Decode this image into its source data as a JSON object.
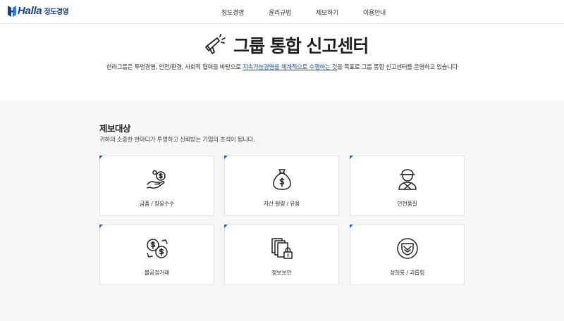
{
  "header": {
    "logo_text": "Halla",
    "logo_sub": "정도경영",
    "nav": [
      "정도경영",
      "윤리규범",
      "제보하기",
      "이용안내"
    ]
  },
  "hero": {
    "title": "그룹 통합 신고센터",
    "desc_before": "한라그룹은 투명경영, 안전/환경, 사회적 협력을 바탕으로 ",
    "desc_highlight": "지속가능경영을 체계적으로 수행하는 것",
    "desc_after": "을 목표로 그룹 통합 신고센터를 운영하고 있습니다"
  },
  "section": {
    "title": "제보대상",
    "desc": "귀하의 소중한 한마디가 투명하고 신뢰받는 기업의 초석이 됩니다."
  },
  "cards": [
    {
      "label": "금품 / 향응수수",
      "icon": "money-hand-icon"
    },
    {
      "label": "자산 횡령 / 유용",
      "icon": "money-bag-icon"
    },
    {
      "label": "안전품질",
      "icon": "worker-icon"
    },
    {
      "label": "불공정거래",
      "icon": "coins-exchange-icon"
    },
    {
      "label": "정보보안",
      "icon": "document-lock-icon"
    },
    {
      "label": "성희롱 / 괴롭힘",
      "icon": "shield-icon"
    }
  ],
  "colors": {
    "brand": "#1b3f8f",
    "accent": "#1d62c8",
    "background": "#f7f7f7"
  }
}
